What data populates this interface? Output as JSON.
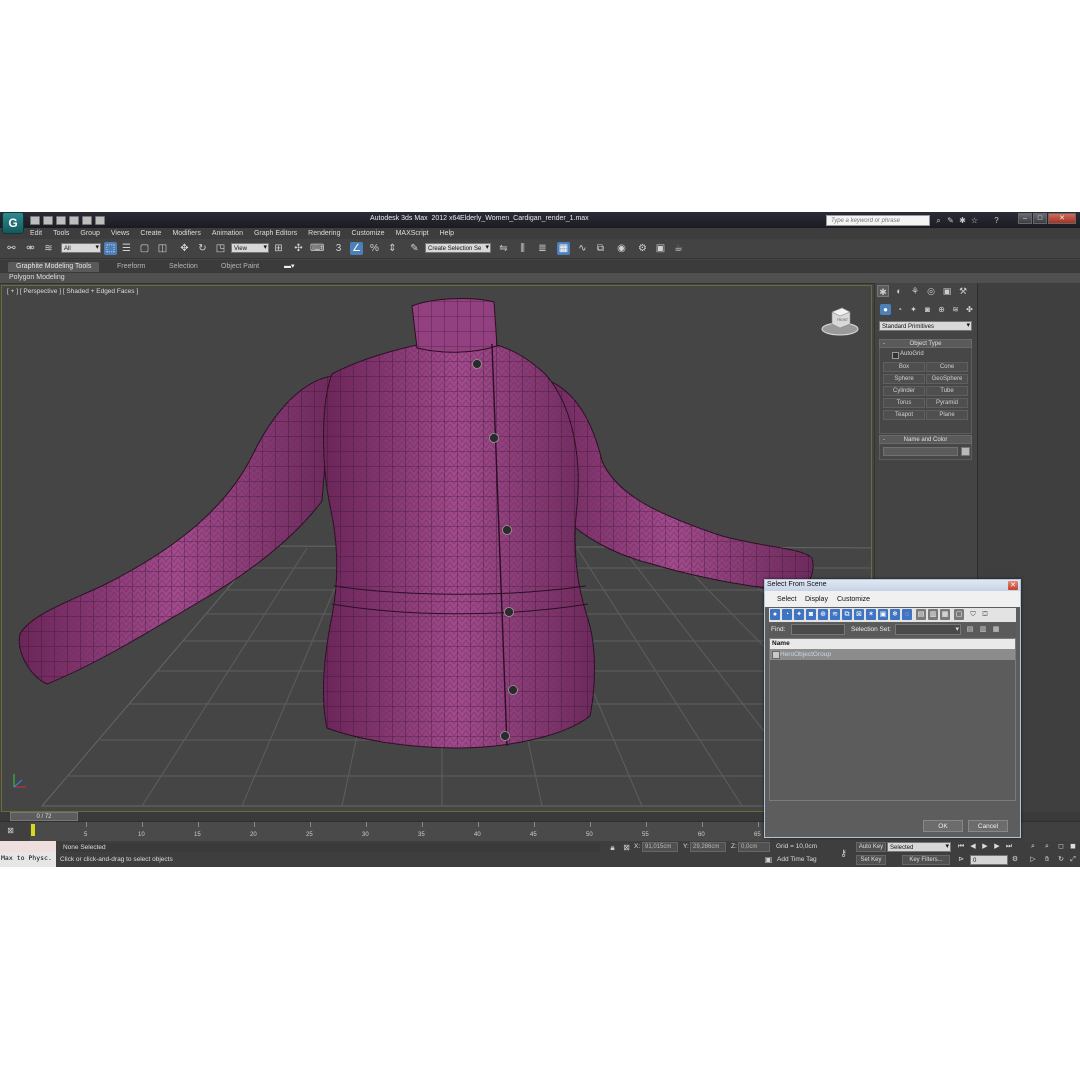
{
  "titlebar": {
    "app_title": "Autodesk 3ds Max  2012 x64",
    "file_name": "Elderly_Women_Cardigan_render_1.max",
    "search_placeholder": "Type a keyword or phrase",
    "logo_glyph": "G"
  },
  "menu": [
    "Edit",
    "Tools",
    "Group",
    "Views",
    "Create",
    "Modifiers",
    "Animation",
    "Graph Editors",
    "Rendering",
    "Customize",
    "MAXScript",
    "Help"
  ],
  "toolbar": {
    "filter": "All",
    "coord_system": "View",
    "selection_set": "Create Selection Se"
  },
  "ribbon": {
    "tabs": [
      "Graphite Modeling Tools",
      "Freeform",
      "Selection",
      "Object Paint"
    ],
    "panel_label": "Polygon Modeling"
  },
  "viewport": {
    "label": "[ + ] [ Perspective ] [ Shaded + Edged Faces ]",
    "viewcube_label": "FRONT",
    "object_color": "#8e3a78"
  },
  "command_panel": {
    "category": "Standard Primitives",
    "object_type_title": "Object Type",
    "autogrid": "AutoGrid",
    "primitives": [
      "Box",
      "Cone",
      "Sphere",
      "GeoSphere",
      "Cylinder",
      "Tube",
      "Torus",
      "Pyramid",
      "Teapot",
      "Plane"
    ],
    "name_color_title": "Name and Color"
  },
  "timeline": {
    "slider_label": "0 / 72",
    "ticks": [
      "5",
      "10",
      "15",
      "20",
      "25",
      "30",
      "35",
      "40",
      "45",
      "50",
      "55",
      "60",
      "65"
    ]
  },
  "status": {
    "maxscript_text": "Max to Physc.",
    "selection": "None Selected",
    "prompt": "Click or click-and-drag to select objects",
    "x_label": "X:",
    "x_value": "91,015cm",
    "y_label": "Y:",
    "y_value": "29,286cm",
    "z_label": "Z:",
    "z_value": "0,0cm",
    "grid": "Grid = 10,0cm",
    "add_time_tag": "Add Time Tag",
    "auto_key": "Auto Key",
    "set_key": "Set Key",
    "key_mode": "Selected",
    "key_filters": "Key Filters...",
    "current_frame": "0"
  },
  "dialog": {
    "title": "Select From Scene",
    "menu": [
      "Select",
      "Display",
      "Customize"
    ],
    "find_label": "Find:",
    "selection_set_label": "Selection Set:",
    "column_name": "Name",
    "items": [
      "HeroObjectGroup"
    ],
    "ok": "OK",
    "cancel": "Cancel"
  }
}
